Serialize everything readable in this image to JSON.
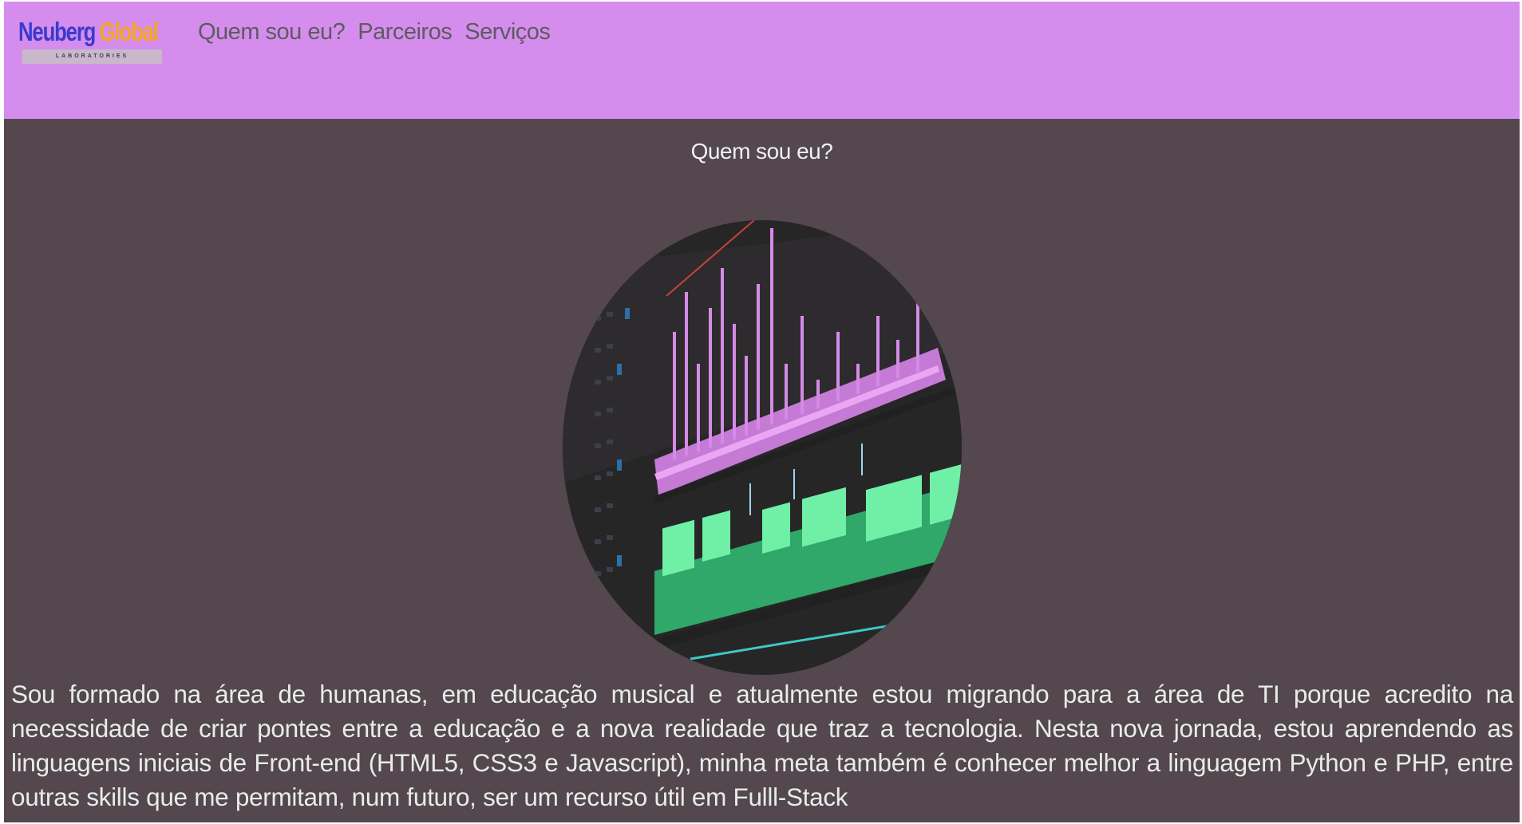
{
  "logo": {
    "word1": "Neuberg",
    "word2": "Global",
    "subtitle": "LABORATORIES",
    "colors": {
      "word1": "#3a3acf",
      "word2": "#f5a623"
    }
  },
  "nav": {
    "items": [
      {
        "label": "Quem sou eu?"
      },
      {
        "label": "Parceiros"
      },
      {
        "label": "Serviços"
      }
    ]
  },
  "main": {
    "title": "Quem sou eu?",
    "image": {
      "icon": "video-editing-timeline-photo"
    },
    "bio": "Sou formado na área de humanas, em educação musical e atualmente estou migrando para a área de TI porque acredito na necessidade de criar pontes entre a educação e a nova realidade que traz a tecnologia. Nesta nova jornada, estou aprendendo as linguagens iniciais de Front-end (HTML5, CSS3 e Javascript), minha meta também é conhecer melhor a linguagem Python e PHP, entre outras skills que me permitam, num futuro, ser um recurso útil em Fulll-Stack"
  },
  "colors": {
    "header_bg": "#d48ded",
    "body_bg": "#54474e",
    "nav_text": "#5f5a61",
    "body_text": "#e7ece9"
  }
}
